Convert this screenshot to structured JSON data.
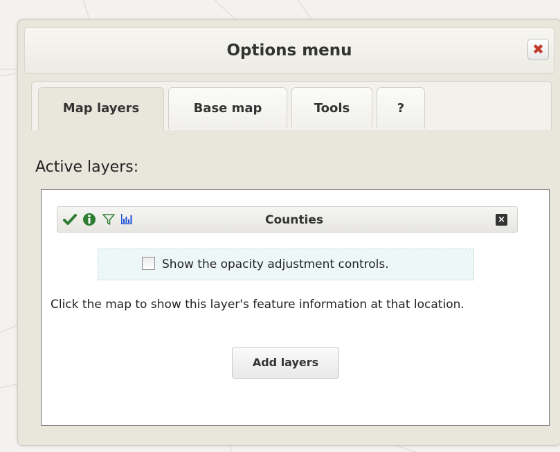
{
  "dialog": {
    "title": "Options menu",
    "close_icon": "close-x-icon",
    "close_color": "#c0392b"
  },
  "tabs": [
    {
      "label": "Map layers",
      "active": true
    },
    {
      "label": "Base map",
      "active": false
    },
    {
      "label": "Tools",
      "active": false
    },
    {
      "label": "?",
      "active": false
    }
  ],
  "active_layers": {
    "heading": "Active layers:",
    "layer": {
      "name": "Counties",
      "icons": [
        "checkmark-icon",
        "info-icon",
        "filter-icon",
        "chart-icon"
      ],
      "remove_icon": "remove-layer-icon",
      "colors": {
        "check": "#2e7d32",
        "info": "#2e7d32",
        "filter": "#2e7d32",
        "chart": "#1e4fd8"
      }
    },
    "opacity_label": "Show the opacity adjustment controls.",
    "opacity_checked": false,
    "info_text": "Click the map to show this layer's feature information at that location.",
    "add_button_label": "Add layers"
  }
}
